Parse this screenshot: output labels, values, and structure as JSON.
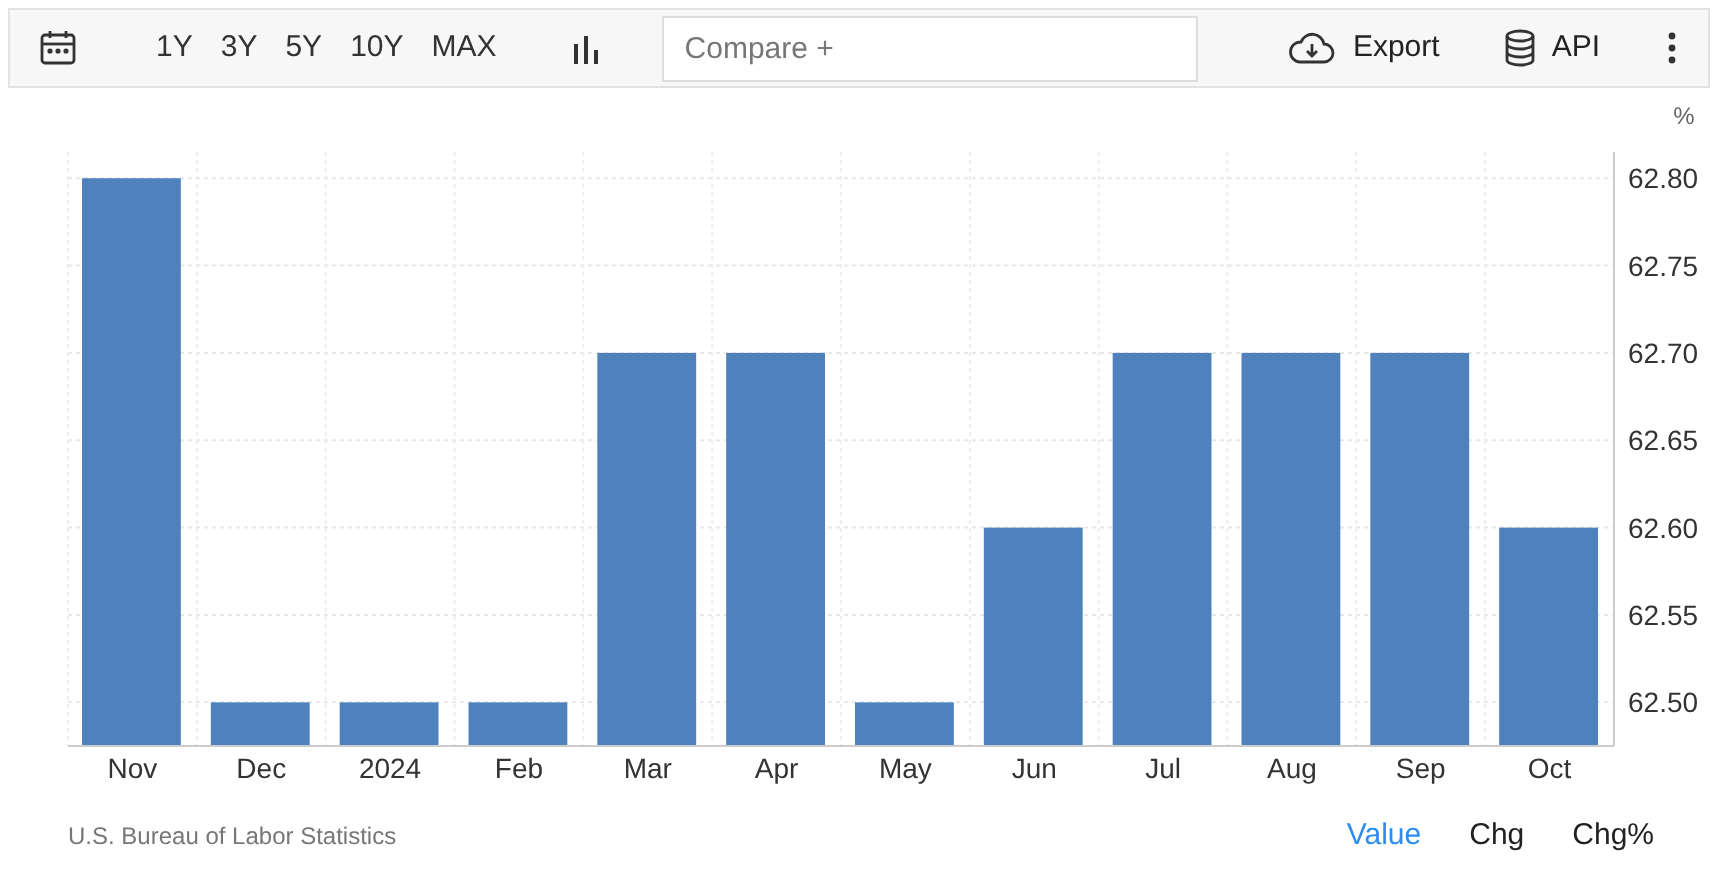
{
  "toolbar": {
    "ranges": [
      {
        "label": "1Y",
        "selected": false
      },
      {
        "label": "3Y",
        "selected": false
      },
      {
        "label": "5Y",
        "selected": false
      },
      {
        "label": "10Y",
        "selected": false
      },
      {
        "label": "MAX",
        "selected": false
      }
    ],
    "compare": {
      "placeholder": "Compare +"
    },
    "export": "Export",
    "api": "API"
  },
  "chart": {
    "unit": "%",
    "chart_data": {
      "type": "bar",
      "categories": [
        "Nov",
        "Dec",
        "2024",
        "Feb",
        "Mar",
        "Apr",
        "May",
        "Jun",
        "Jul",
        "Aug",
        "Sep",
        "Oct"
      ],
      "grid": true,
      "series": [
        {
          "color": "#4f81bd",
          "values": [
            62.8,
            62.5,
            62.5,
            62.5,
            62.7,
            62.7,
            62.5,
            62.6,
            62.7,
            62.7,
            62.7,
            62.6
          ]
        }
      ],
      "ylim": [
        62.475,
        62.815
      ],
      "yticks": [
        {
          "value": 62.5,
          "label": "62.50"
        },
        {
          "value": 62.55,
          "label": "62.55"
        },
        {
          "value": 62.6,
          "label": "62.60"
        },
        {
          "value": 62.65,
          "label": "62.65"
        },
        {
          "value": 62.7,
          "label": "62.70"
        },
        {
          "value": 62.75,
          "label": "62.75"
        },
        {
          "value": 62.8,
          "label": "62.80"
        }
      ]
    }
  },
  "footer": {
    "source": "U.S. Bureau of Labor Statistics",
    "views": [
      {
        "label": "Value",
        "selected": true
      },
      {
        "label": "Chg",
        "selected": false
      },
      {
        "label": "Chg%",
        "selected": false
      }
    ]
  }
}
